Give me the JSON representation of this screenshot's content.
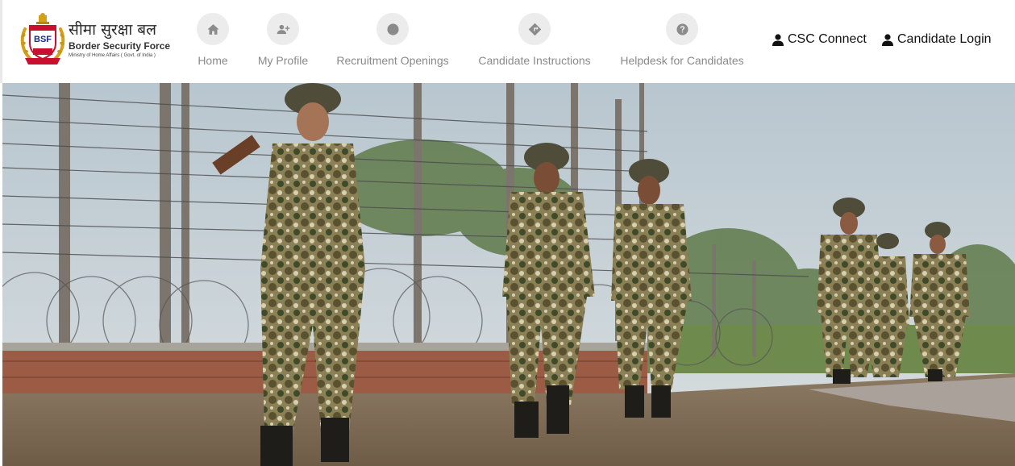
{
  "brand": {
    "badge": "BSF",
    "hindi_name": "सीमा सुरक्षा बल",
    "english_name": "Border Security Force",
    "ministry": "Ministry of Home Affairs ( Govt. of India )"
  },
  "nav": [
    {
      "label": "Home",
      "icon": "home-icon"
    },
    {
      "label": "My Profile",
      "icon": "user-plus-icon"
    },
    {
      "label": "Recruitment Openings",
      "icon": "globe-icon"
    },
    {
      "label": "Candidate Instructions",
      "icon": "direction-sign-icon"
    },
    {
      "label": "Helpdesk for Candidates",
      "icon": "question-circle-icon"
    }
  ],
  "top_links": {
    "csc": "CSC Connect",
    "login": "Candidate Login"
  },
  "hero": {
    "description": "Photo banner of BSF personnel in camouflage uniforms walking along a barbed-wire border fence"
  },
  "colors": {
    "nav_icon_bg": "#ececec",
    "nav_icon_fg": "#8b8b8b",
    "nav_label": "#8a8a8a",
    "link_text": "#111111",
    "emblem_red": "#c8102e",
    "emblem_gold": "#d4a017"
  }
}
